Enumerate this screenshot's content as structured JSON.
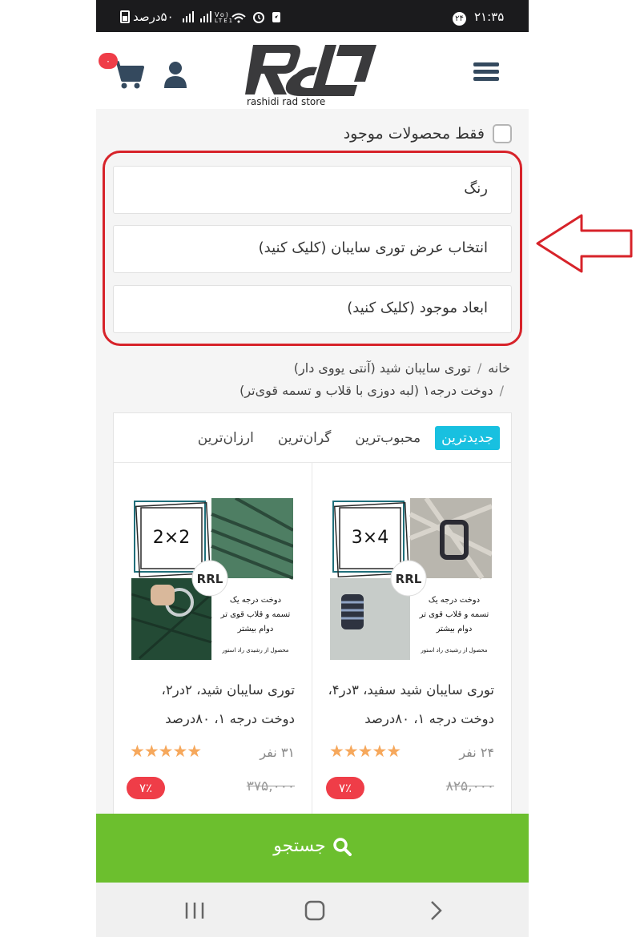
{
  "status_bar": {
    "time": "۲۱:۳۵",
    "notification_badge": "۲۴",
    "battery_text": "۵۰درصد",
    "network_text": "Vo) LTE1"
  },
  "header": {
    "logo_caption": "rashidi rad store",
    "cart_count": "۰"
  },
  "filters": {
    "in_stock_label": "فقط محصولات موجود",
    "color_label": "رنگ",
    "width_label": "انتخاب عرض توری سایبان (کلیک کنید)",
    "dimensions_label": "ابعاد موجود (کلیک کنید)"
  },
  "breadcrumb": {
    "home": "خانه",
    "category": "توری سایبان شید (آنتی یووی دار)",
    "subcategory": "دوخت درجه۱ (لبه دوزی با قلاب و تسمه قوی‌تر)"
  },
  "sort_tabs": [
    "جدیدترین",
    "محبوب‌ترین",
    "گران‌ترین",
    "ارزان‌ترین"
  ],
  "products": [
    {
      "title": "توری سایبان شید سفید، ۳در۴، دوخت درجه ۱، ۸۰درصد",
      "size_text": "3×4",
      "rating_count": "۲۴ نفر",
      "old_price": "۸۲۵,۰۰۰",
      "discount": "۷٪",
      "img_line1": "دوخت درجه یک",
      "img_line2": "تسمه و قلاب قوی تر",
      "img_line3": "دوام بیشتر",
      "img_footer": "محصول از رشیدی راد استور"
    },
    {
      "title": "توری سایبان شید، ۲در۲، دوخت درجه ۱، ۸۰درصد",
      "size_text": "2×2",
      "rating_count": "۳۱ نفر",
      "old_price": "۳۷۵,۰۰۰",
      "discount": "۷٪",
      "img_line1": "دوخت درجه یک",
      "img_line2": "تسمه و قلاب قوی تر",
      "img_line3": "دوام بیشتر",
      "img_footer": "محصول از رشیدی راد استور"
    }
  ],
  "search_button": "جستجو",
  "colors": {
    "accent_tab": "#18c0e0",
    "search_green": "#6cbf2e",
    "discount_red": "#ef3d48",
    "highlight_red": "#d7232a",
    "star_orange": "#f6a85c"
  }
}
